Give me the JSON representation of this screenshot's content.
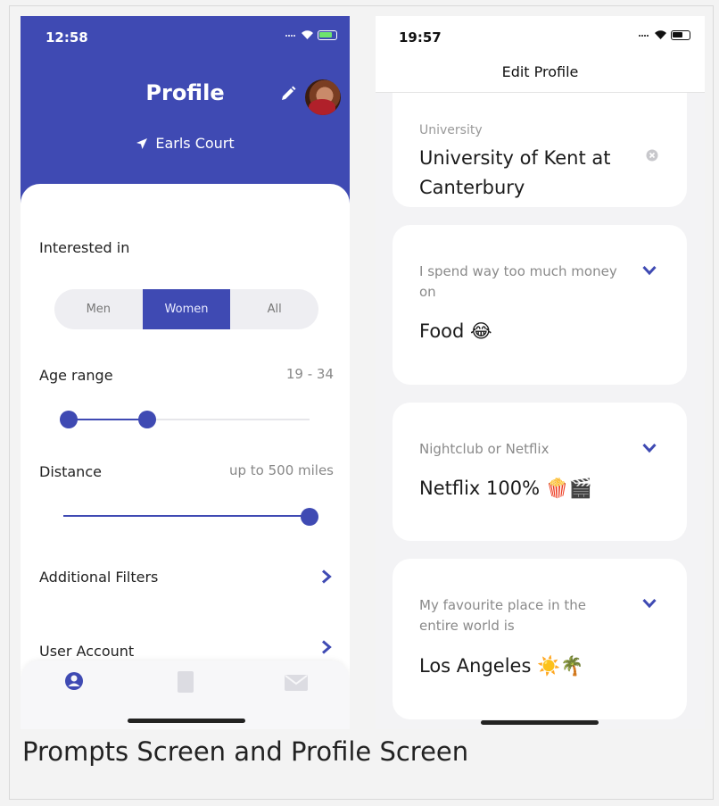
{
  "left_screen": {
    "status_time": "12:58",
    "title": "Profile",
    "location": "Earls Court",
    "interested_in": {
      "label": "Interested in",
      "options": [
        "Men",
        "Women",
        "All"
      ],
      "selected": "Women"
    },
    "age_range": {
      "label": "Age range",
      "value": "19 - 34"
    },
    "distance": {
      "label": "Distance",
      "value": "up to 500 miles"
    },
    "menu": [
      {
        "label": "Additional Filters"
      },
      {
        "label": "User Account"
      }
    ],
    "tabs": [
      "profile-icon",
      "cards-icon",
      "mail-icon"
    ],
    "accent_color": "#3f4ab3"
  },
  "right_screen": {
    "status_time": "19:57",
    "title": "Edit Profile",
    "cut_label": "University",
    "prompts": [
      {
        "question": "",
        "answer": "University of Kent at Canterbury"
      },
      {
        "question": "I spend way too much money on",
        "answer": "Food 😂"
      },
      {
        "question": "Nightclub or Netflix",
        "answer": "Netflix 100% 🍿🎬"
      },
      {
        "question": "My favourite place in the entire world is",
        "answer": "Los Angeles ☀️🌴"
      }
    ]
  },
  "caption": "Prompts Screen and Profile Screen"
}
